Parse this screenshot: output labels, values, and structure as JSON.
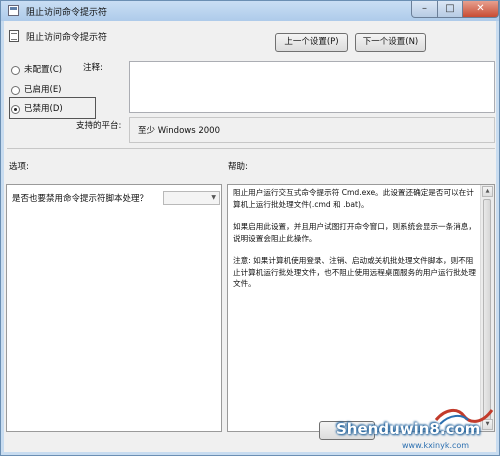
{
  "window": {
    "title": "阻止访问命令提示符",
    "close_symbol": "✕",
    "minimize_symbol": "–",
    "maximize_symbol": "□"
  },
  "header": {
    "setting_name": "阻止访问命令提示符",
    "prev_button": "上一个设置(P)",
    "next_button": "下一个设置(N)"
  },
  "state": {
    "options": [
      {
        "label": "未配置(C)",
        "checked": false
      },
      {
        "label": "已启用(E)",
        "checked": false
      },
      {
        "label": "已禁用(D)",
        "checked": true
      }
    ]
  },
  "comment": {
    "label": "注释:",
    "value": ""
  },
  "platform": {
    "label": "支持的平台:",
    "value": "至少 Windows 2000"
  },
  "options_section": {
    "label": "选项:",
    "question": "是否也要禁用命令提示符脚本处理？",
    "dropdown_value": ""
  },
  "help_section": {
    "label": "帮助:",
    "paragraphs": [
      "阻止用户运行交互式命令提示符 Cmd.exe。此设置还确定是否可以在计算机上运行批处理文件(.cmd 和 .bat)。",
      "如果启用此设置，并且用户试图打开命令窗口，则系统会显示一条消息，说明设置会阻止此操作。",
      "注意: 如果计算机使用登录、注销、启动或关机批处理文件脚本，则不阻止计算机运行批处理文件，也不阻止使用远程桌面服务的用户运行批处理文件。"
    ]
  },
  "watermark": {
    "main": "Shenduwin8.com",
    "sub": "www.kxinyk.com"
  },
  "colors": {
    "titlebar": "#aecbea",
    "client_bg": "#f0f0f0",
    "close_button": "#c84c34",
    "watermark_blue": "#1d5f9a"
  }
}
